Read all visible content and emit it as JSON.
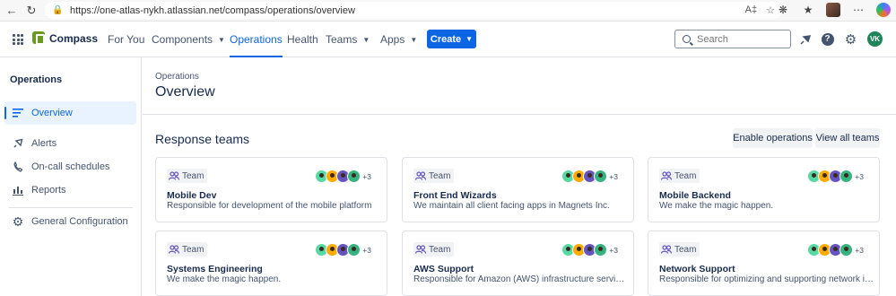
{
  "browser": {
    "url": "https://one-atlas-nykh.atlassian.net/compass/operations/overview"
  },
  "header": {
    "product": "Compass",
    "nav": [
      "For You",
      "Components",
      "Operations",
      "Health",
      "Teams",
      "Apps"
    ],
    "create_label": "Create",
    "search_placeholder": "Search",
    "user_initials": "VK"
  },
  "sidebar": {
    "title": "Operations",
    "items": [
      {
        "label": "Overview",
        "icon": "list-icon",
        "active": true
      },
      {
        "label": "Alerts",
        "icon": "megaphone-icon"
      },
      {
        "label": "On-call schedules",
        "icon": "phone-icon"
      },
      {
        "label": "Reports",
        "icon": "bar-chart-icon"
      },
      {
        "label": "General Configuration",
        "icon": "gear-icon"
      }
    ]
  },
  "main": {
    "breadcrumb": "Operations",
    "title": "Overview",
    "section_title": "Response teams",
    "enable_label": "Enable operations",
    "view_all_label": "View all teams",
    "teams": [
      {
        "tag": "Team",
        "name": "Mobile Dev",
        "desc": "Responsible for development of the mobile platform",
        "more": "+3"
      },
      {
        "tag": "Team",
        "name": "Front End Wizards",
        "desc": "We maintain all client facing apps in Magnets Inc.",
        "more": "+3"
      },
      {
        "tag": "Team",
        "name": "Mobile Backend",
        "desc": "We make the magic happen.",
        "more": "+3"
      },
      {
        "tag": "Team",
        "name": "Systems Engineering",
        "desc": "We make the magic happen.",
        "more": "+3"
      },
      {
        "tag": "Team",
        "name": "AWS Support",
        "desc": "Responsible for Amazon (AWS) infrastructure services",
        "more": "+3"
      },
      {
        "tag": "Team",
        "name": "Network Support",
        "desc": "Responsible for optimizing and supporting network infr...",
        "more": "+3"
      }
    ]
  }
}
